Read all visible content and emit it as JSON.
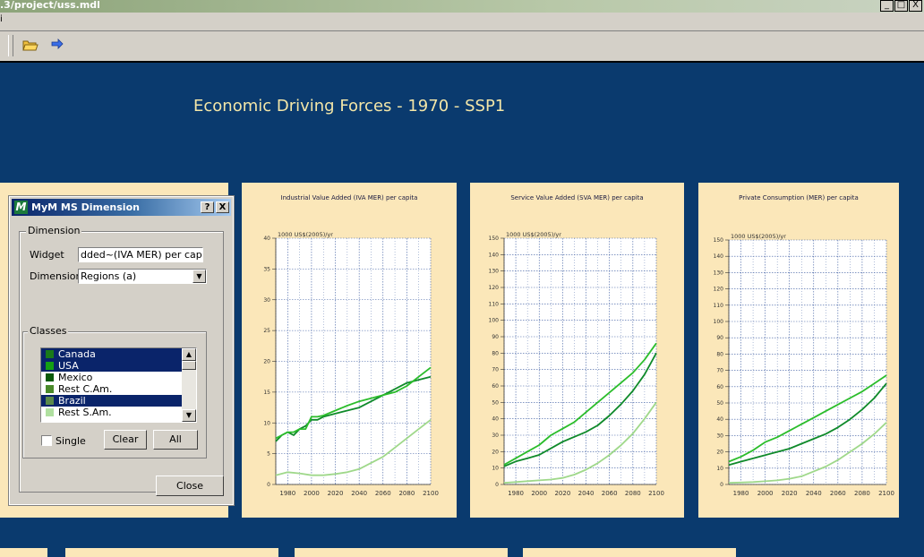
{
  "window": {
    "title": ".3/project/uss.mdl",
    "buttons": [
      "_",
      "□",
      "X"
    ]
  },
  "menubar": {
    "stub": "i"
  },
  "toolbar": {
    "items": [
      "open-folder-icon",
      "forward-arrow-icon"
    ]
  },
  "page": {
    "heading": "Economic Driving Forces - 1970 - SSP1"
  },
  "dialog": {
    "title": "MyM MS Dimension",
    "logo": "M",
    "help_btn": "?",
    "close_x": "X",
    "dimension_group": "Dimension",
    "widget_label": "Widget",
    "widget_value": "dded~(IVA MER) per capita",
    "dimension_label": "Dimension",
    "dimension_value": "Regions (a)",
    "classes_group": "Classes",
    "classes": [
      {
        "label": "Canada",
        "selected": true,
        "color": "#1a7a1a"
      },
      {
        "label": "USA",
        "selected": true,
        "color": "#14a014"
      },
      {
        "label": "Mexico",
        "selected": false,
        "color": "#0a5a0a"
      },
      {
        "label": "Rest C.Am.",
        "selected": false,
        "color": "#4a8a2a"
      },
      {
        "label": "Brazil",
        "selected": true,
        "color": "#5a8a4a"
      },
      {
        "label": "Rest S.Am.",
        "selected": false,
        "color": "#b0e0a0"
      }
    ],
    "single_label": "Single",
    "clear_label": "Clear",
    "all_label": "All",
    "close_label": "Close"
  },
  "chart_data": [
    {
      "type": "line",
      "title": "Industrial Value Added (IVA MER) per capita",
      "ylabel": "1000 US$(2005)/yr",
      "xlim": [
        1970,
        2100
      ],
      "ylim": [
        0,
        40
      ],
      "yticks": [
        0,
        5,
        10,
        15,
        20,
        25,
        30,
        35,
        40
      ],
      "xticks": [
        1980,
        2000,
        2020,
        2040,
        2060,
        2080,
        2100
      ],
      "grid": true,
      "series": [
        {
          "color": "#0f8a2a",
          "x": [
            1970,
            1975,
            1980,
            1985,
            1990,
            1995,
            2000,
            2005,
            2010,
            2020,
            2030,
            2040,
            2050,
            2060,
            2070,
            2080,
            2090,
            2100
          ],
          "y": [
            7,
            8,
            8.5,
            8,
            9,
            9.5,
            10.5,
            10.5,
            11,
            11.5,
            12,
            12.5,
            13.5,
            14.5,
            15.5,
            16.5,
            17,
            17.5
          ]
        },
        {
          "color": "#2bbd2b",
          "x": [
            1970,
            1975,
            1980,
            1985,
            1990,
            1995,
            2000,
            2005,
            2010,
            2020,
            2030,
            2040,
            2050,
            2060,
            2070,
            2080,
            2090,
            2100
          ],
          "y": [
            7.5,
            8,
            8.5,
            8.5,
            9,
            9,
            11,
            11,
            11.2,
            12,
            12.8,
            13.5,
            14,
            14.5,
            15,
            16,
            17.5,
            19
          ]
        },
        {
          "color": "#9fd88a",
          "x": [
            1970,
            1980,
            1990,
            2000,
            2010,
            2020,
            2030,
            2040,
            2050,
            2060,
            2070,
            2080,
            2090,
            2100
          ],
          "y": [
            1.5,
            2,
            1.8,
            1.5,
            1.5,
            1.7,
            2,
            2.5,
            3.5,
            4.5,
            6,
            7.5,
            9,
            10.5
          ]
        }
      ]
    },
    {
      "type": "line",
      "title": "Service Value Added (SVA MER) per capita",
      "ylabel": "1000 US$(2005)/yr",
      "xlim": [
        1970,
        2100
      ],
      "ylim": [
        0,
        150
      ],
      "yticks": [
        0,
        10,
        20,
        30,
        40,
        50,
        60,
        70,
        80,
        90,
        100,
        110,
        120,
        130,
        140,
        150
      ],
      "xticks": [
        1980,
        2000,
        2020,
        2040,
        2060,
        2080,
        2100
      ],
      "grid": true,
      "series": [
        {
          "color": "#0f8a2a",
          "x": [
            1970,
            1980,
            1990,
            2000,
            2010,
            2020,
            2030,
            2040,
            2050,
            2060,
            2070,
            2080,
            2090,
            2100
          ],
          "y": [
            11,
            14,
            16,
            18,
            22,
            26,
            29,
            32,
            36,
            42,
            49,
            57,
            67,
            80
          ]
        },
        {
          "color": "#2bbd2b",
          "x": [
            1970,
            1980,
            1990,
            2000,
            2010,
            2020,
            2030,
            2040,
            2050,
            2060,
            2070,
            2080,
            2090,
            2100
          ],
          "y": [
            12,
            16,
            20,
            24,
            30,
            34,
            38,
            44,
            50,
            56,
            62,
            68,
            76,
            86
          ]
        },
        {
          "color": "#9fd88a",
          "x": [
            1970,
            1980,
            1990,
            2000,
            2010,
            2020,
            2030,
            2040,
            2050,
            2060,
            2070,
            2080,
            2090,
            2100
          ],
          "y": [
            1,
            1.5,
            2,
            2.5,
            3,
            4,
            6,
            9,
            13,
            18,
            24,
            31,
            40,
            50
          ]
        }
      ]
    },
    {
      "type": "line",
      "title": "Private Consumption (MER) per capita",
      "ylabel": "1000 US$(2005)/yr",
      "xlim": [
        1970,
        2100
      ],
      "ylim": [
        0,
        150
      ],
      "yticks": [
        0,
        10,
        20,
        30,
        40,
        50,
        60,
        70,
        80,
        90,
        100,
        110,
        120,
        130,
        140,
        150
      ],
      "xticks": [
        1980,
        2000,
        2020,
        2040,
        2060,
        2080,
        2100
      ],
      "grid": true,
      "series": [
        {
          "color": "#0f8a2a",
          "x": [
            1970,
            1980,
            1990,
            2000,
            2010,
            2020,
            2030,
            2040,
            2050,
            2060,
            2070,
            2080,
            2090,
            2100
          ],
          "y": [
            12,
            14,
            16,
            18,
            20,
            22,
            25,
            28,
            31,
            35,
            40,
            46,
            53,
            62
          ]
        },
        {
          "color": "#2bbd2b",
          "x": [
            1970,
            1980,
            1990,
            2000,
            2010,
            2020,
            2030,
            2040,
            2050,
            2060,
            2070,
            2080,
            2090,
            2100
          ],
          "y": [
            14,
            17,
            21,
            26,
            29,
            33,
            37,
            41,
            45,
            49,
            53,
            57,
            62,
            67
          ]
        },
        {
          "color": "#9fd88a",
          "x": [
            1970,
            1980,
            1990,
            2000,
            2010,
            2020,
            2030,
            2040,
            2050,
            2060,
            2070,
            2080,
            2090,
            2100
          ],
          "y": [
            1,
            1.2,
            1.5,
            2,
            2.5,
            3.5,
            5,
            8,
            11,
            15,
            20,
            25,
            31,
            38
          ]
        }
      ]
    }
  ]
}
